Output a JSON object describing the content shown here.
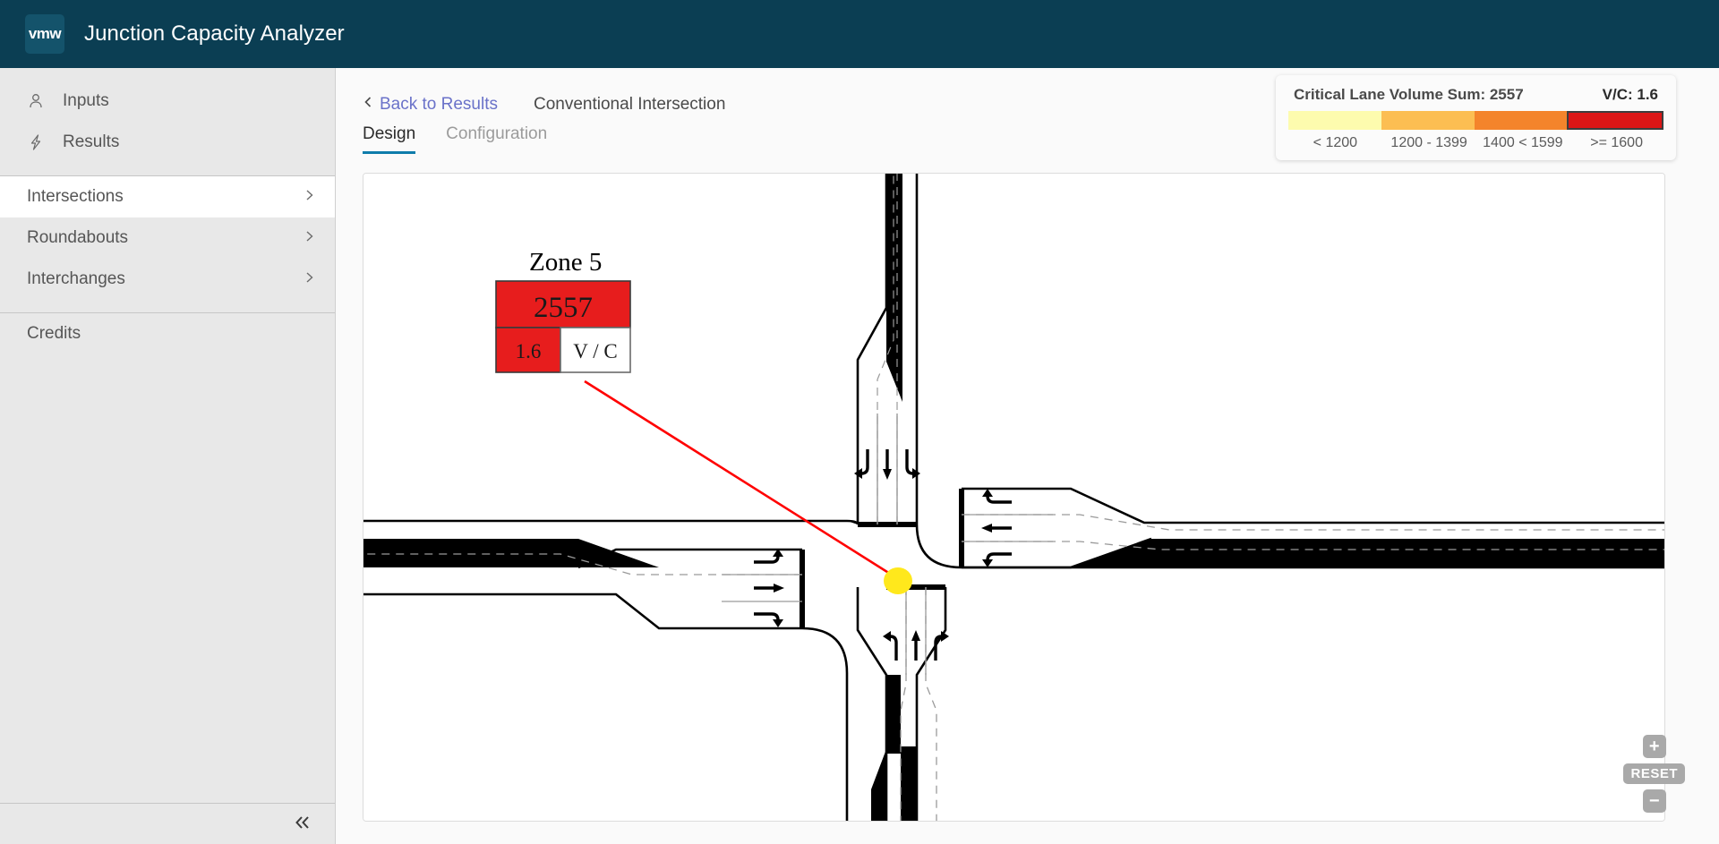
{
  "header": {
    "logo_text": "vmw",
    "title": "Junction Capacity Analyzer"
  },
  "sidebar": {
    "nav": [
      {
        "label": "Inputs",
        "icon": "user-icon"
      },
      {
        "label": "Results",
        "icon": "lightning-icon"
      }
    ],
    "tree": [
      {
        "label": "Intersections",
        "active": true
      },
      {
        "label": "Roundabouts",
        "active": false
      },
      {
        "label": "Interchanges",
        "active": false
      }
    ],
    "credits": {
      "label": "Credits"
    },
    "collapse_icon": "«"
  },
  "main": {
    "back_link": "Back to Results",
    "back_icon": "chevron-left-icon",
    "page_title": "Conventional Intersection",
    "tabs": [
      {
        "label": "Design",
        "active": true
      },
      {
        "label": "Configuration",
        "active": false
      }
    ]
  },
  "legend": {
    "title": "Critical Lane Volume Sum: 2557",
    "vc": "V/C: 1.6",
    "bands": [
      {
        "label": "< 1200",
        "color": "#fdfbae",
        "selected": false
      },
      {
        "label": "1200 - 1399",
        "color": "#fcbe52",
        "selected": false
      },
      {
        "label": "1400 < 1599",
        "color": "#f4842b",
        "selected": false
      },
      {
        "label": ">= 1600",
        "color": "#dc1616",
        "selected": true
      }
    ]
  },
  "diagram": {
    "zone_label": "Zone 5",
    "volume": "2557",
    "vc_value": "1.6",
    "vc_caption": "V / C",
    "callout_color": "#e71d1d",
    "marker_color": "#ffe81c",
    "leader_color": "#ff0000",
    "approaches": [
      {
        "name": "north-approach",
        "lanes": [
          "left",
          "through",
          "right"
        ]
      },
      {
        "name": "south-approach",
        "lanes": [
          "left",
          "through",
          "right"
        ]
      },
      {
        "name": "east-approach",
        "lanes": [
          "left",
          "through",
          "right"
        ]
      },
      {
        "name": "west-approach",
        "lanes": [
          "left",
          "through",
          "right"
        ]
      }
    ]
  },
  "zoom_controls": {
    "zoom_in": "+",
    "reset": "RESET",
    "zoom_out": "−"
  }
}
